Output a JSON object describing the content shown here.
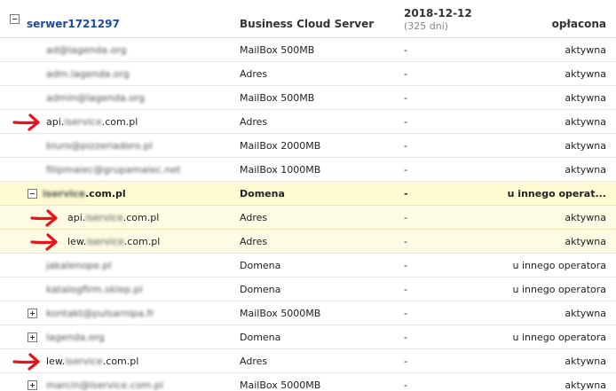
{
  "header": {
    "server_name": "serwer1721297",
    "service_type": "Business Cloud Server",
    "date": "2018-12-12",
    "days_left": "(325 dni)",
    "status": "opłacona"
  },
  "rows": [
    {
      "name": "ad@lagenda.org",
      "type": "MailBox 500MB",
      "date": "-",
      "status": "aktywna"
    },
    {
      "name": "adm.lagenda.org",
      "type": "Adres",
      "date": "-",
      "status": "aktywna"
    },
    {
      "name": "admin@lagenda.org",
      "type": "MailBox 500MB",
      "date": "-",
      "status": "aktywna"
    },
    {
      "name": "api.iservice.com.pl",
      "name_visible": "api.",
      "name_blurred": "iservice",
      "name_suffix": ".com.pl",
      "type": "Adres",
      "date": "-",
      "status": "aktywna"
    },
    {
      "name": "biuro@pizzeriadoro.pl",
      "type": "MailBox 2000MB",
      "date": "-",
      "status": "aktywna"
    },
    {
      "name": "filipmaiec@grupamalec.net",
      "type": "MailBox 1000MB",
      "date": "-",
      "status": "aktywna"
    },
    {
      "name": "iservice.com.pl",
      "name_visible": "",
      "name_blurred": "iservice",
      "name_suffix": ".com.pl",
      "type": "Domena",
      "date": "-",
      "status": "u innego operat..."
    },
    {
      "name": "api.iservice.com.pl",
      "name_visible": "api.",
      "name_blurred": "iservice",
      "name_suffix": ".com.pl",
      "type": "Adres",
      "date": "-",
      "status": "aktywna"
    },
    {
      "name": "lew.iservice.com.pl",
      "name_visible": "lew.",
      "name_blurred": "iservice",
      "name_suffix": ".com.pl",
      "type": "Adres",
      "date": "-",
      "status": "aktywna"
    },
    {
      "name": "jakalenope.pl",
      "type": "Domena",
      "date": "-",
      "status": "u innego operatora"
    },
    {
      "name": "katalogfirm.sklep.pl",
      "type": "Domena",
      "date": "-",
      "status": "u innego operatora"
    },
    {
      "name": "kontakt@pulsarnipa.fr",
      "type": "MailBox 5000MB",
      "date": "-",
      "status": "aktywna"
    },
    {
      "name": "lagenda.org",
      "type": "Domena",
      "date": "-",
      "status": "u innego operatora"
    },
    {
      "name": "lew.iservice.com.pl",
      "name_visible": "lew.",
      "name_blurred": "iservice",
      "name_suffix": ".com.pl",
      "type": "Adres",
      "date": "-",
      "status": "aktywna"
    },
    {
      "name": "marcin@iservice.com.pl",
      "type": "MailBox 5000MB",
      "date": "-",
      "status": "aktywna"
    }
  ],
  "icons": {
    "collapse": "minus-square-icon",
    "expand": "plus-square-icon",
    "annotation": "red-arrow-icon"
  },
  "colors": {
    "link": "#1b4aa3",
    "highlight_row": "#fefad2",
    "sub_row": "#fdfbe3",
    "arrow": "#e8141c"
  }
}
